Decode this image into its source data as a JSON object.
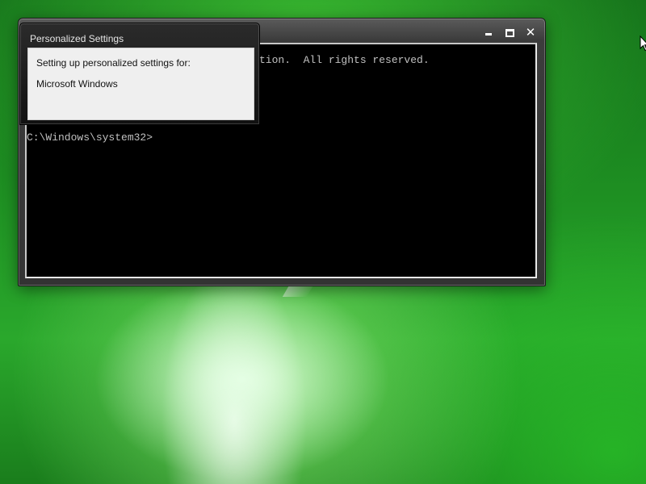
{
  "desktop": {
    "background": "green-glow-wallpaper"
  },
  "cmd_window": {
    "controls": {
      "minimize_icon": "minimize-icon",
      "maximize_icon": "maximize-icon",
      "close_symbol": "✕"
    },
    "console_lines": [
      "tion.  All rights reserved.",
      "C:\\Windows\\system32>"
    ],
    "colors": {
      "console_bg": "#000000",
      "console_text": "#c0c0c0"
    }
  },
  "personalized_settings": {
    "title": "Personalized Settings",
    "line1": "Setting up personalized settings for:",
    "line2": "Microsoft Windows"
  },
  "cursor": {
    "icon": "mouse-pointer-icon"
  }
}
